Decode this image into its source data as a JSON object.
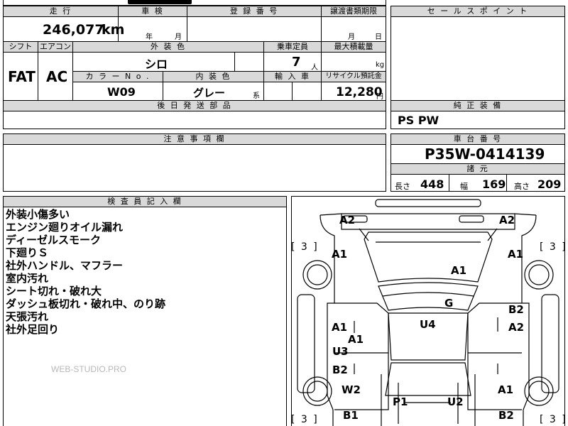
{
  "header": {
    "mileage_label": "走 行",
    "inspection_label": "車 検",
    "registration_label": "登 録 番 号",
    "transfer_doc_label": "譲渡書類期限",
    "sales_point_label": "セ ー ル ス ポ イ ン ト"
  },
  "mileage": {
    "value": "246,077",
    "unit": "km"
  },
  "inspection": {
    "year_unit": "年",
    "month_unit": "月"
  },
  "transfer_doc": {
    "month_unit": "月",
    "day_unit": "日"
  },
  "specs": {
    "shift_label": "シフト",
    "aircon_label": "エアコン",
    "exterior_color_label": "外 装 色",
    "capacity_label": "乗車定員",
    "max_load_label": "最大積載量",
    "shift_value": "FAT",
    "aircon_value": "AC",
    "exterior_color_value": "シロ",
    "capacity_value": "7",
    "capacity_unit": "人",
    "max_load_unit": "kg",
    "color_no_label": "カ ラ ー N o .",
    "interior_color_label": "内 装 色",
    "import_label": "輸 入 車",
    "recycle_label": "リサイクル預託金",
    "color_no_value": "W09",
    "interior_color_value": "グレー",
    "interior_color_suffix": "系",
    "recycle_value": "12,280",
    "recycle_unit": "円"
  },
  "later_parts_label": "後 日 発 送 部 品",
  "genuine_equipment": {
    "label": "純 正 装 備",
    "value": "PS PW"
  },
  "caution_label": "注 意 事 項 欄",
  "chassis": {
    "label": "車 台 番 号",
    "value": "P35W-0414139",
    "dimensions_label": "諸 元",
    "length_label": "長さ",
    "length_value": "448",
    "width_label": "幅",
    "width_value": "169",
    "height_label": "高さ",
    "height_value": "209"
  },
  "inspector": {
    "label": "検 査 員 記 入 欄",
    "notes": [
      "外装小傷多い",
      "エンジン廻りオイル漏れ",
      "ディーゼルスモーク",
      "下廻りＳ",
      "社外ハンドル、マフラー",
      "室内汚れ",
      "シート切れ・破れ大",
      "ダッシュ板切れ・破れ中、のり跡",
      "天張汚れ",
      "社外足回り"
    ],
    "watermark": "WEB-STUDIO.PRO"
  },
  "diagram": {
    "bracket_top_left": "[ 3 ]",
    "bracket_top_right": "[ 3 ]",
    "bracket_bottom_left": "[ 3 ]",
    "bracket_bottom_right": "[ 3 ]",
    "marks": {
      "front_left": "A2",
      "front_right": "A2",
      "fender_left": "A1",
      "fender_right": "A1",
      "hood": "A1",
      "windshield": "G",
      "front_door_left": "A1",
      "front_door_right_top": "B2",
      "front_door_right": "A2",
      "rocker_left": "A1",
      "roof": "U4",
      "rear_door_left_top": "U3",
      "rear_door_left": "B2",
      "rear_fender_left": "W2",
      "rear_fender_right": "A1",
      "quarter_left": "P1",
      "quarter_right": "U2",
      "rear_left": "B1",
      "rear_right": "B2"
    }
  }
}
